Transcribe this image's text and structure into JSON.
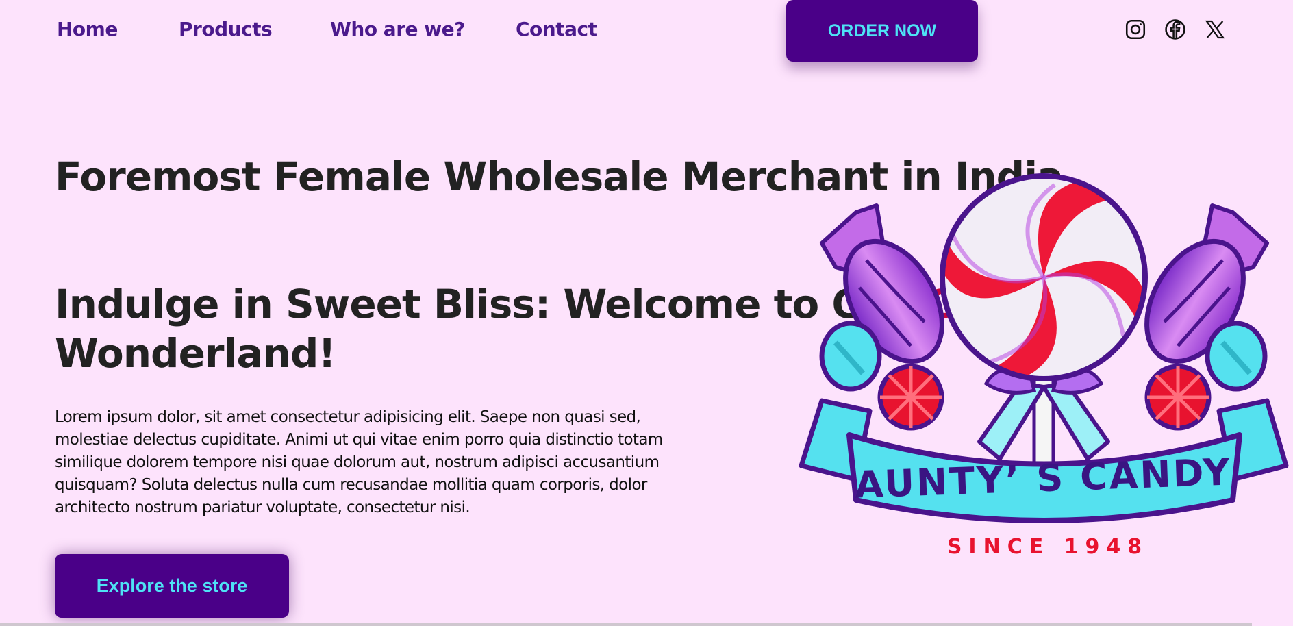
{
  "nav": {
    "links": [
      "Home",
      "Products",
      "Who are we?",
      "Contact"
    ],
    "order_label": "ORDER NOW",
    "social": [
      "instagram-icon",
      "facebook-icon",
      "x-icon"
    ]
  },
  "hero": {
    "title": "Foremost Female Wholesale Merchant in India",
    "subtitle_part1": "Indulge in Sweet Bliss: Welcome to Our ",
    "subtitle_accent": "Candy",
    "subtitle_part2": " Wonderland!",
    "paragraph": "Lorem ipsum dolor, sit amet consectetur adipisicing elit. Saepe non quasi sed, molestiae delectus cupiditate. Animi ut qui vitae enim porro quia distinctio totam similique dolorem tempore nisi quae dolorum aut, nostrum adipisci accusantium quisquam? Soluta delectus nulla cum recusandae mollitia quam corporis, dolor architecto nostrum pariatur voluptate, consectetur nisi.",
    "cta_label": "Explore the store"
  },
  "logo": {
    "banner_text": "AUNTY’ S CANDY",
    "since_text": "SINCE 1948"
  },
  "colors": {
    "background": "#fde3fc",
    "nav_text": "#4b1a8c",
    "button_bg": "#4a0088",
    "button_text": "#4ee2f5",
    "accent": "#c8073e"
  }
}
